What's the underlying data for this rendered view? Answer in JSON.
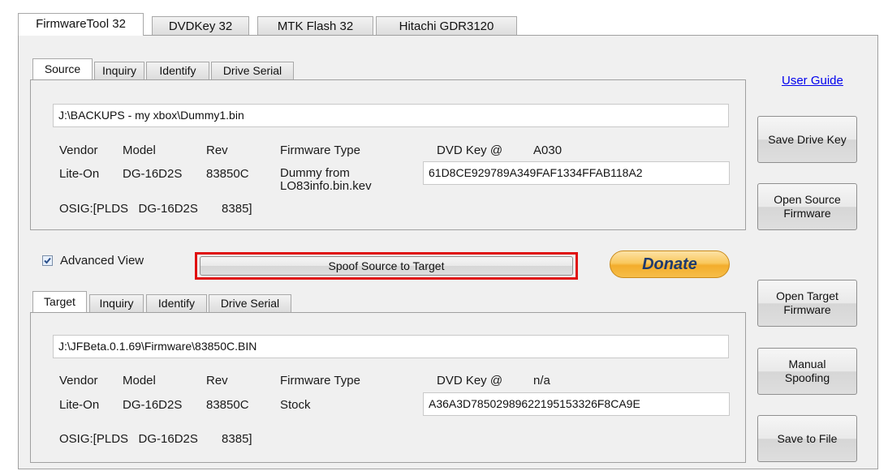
{
  "tabs": [
    "FirmwareTool 32",
    "DVDKey 32",
    "MTK Flash 32",
    "Hitachi GDR3120"
  ],
  "user_guide": "User Guide",
  "source": {
    "tabs": [
      "Source",
      "Inquiry",
      "Identify",
      "Drive Serial"
    ],
    "path": "J:\\BACKUPS - my xbox\\Dummy1.bin",
    "vendor_label": "Vendor",
    "model_label": "Model",
    "rev_label": "Rev",
    "fw_type_label": "Firmware Type",
    "dvd_key_label": "DVD Key @",
    "dvd_key_addr": "A030",
    "vendor": "Lite-On",
    "model": "DG-16D2S",
    "rev": "83850C",
    "fw_type": "Dummy from LO83info.bin.kev",
    "dvd_key": "61D8CE929789A349FAF1334FFAB118A2",
    "osig": "OSIG:[PLDS   DG-16D2S       8385]"
  },
  "advanced_view": {
    "label": "Advanced View",
    "checked": true
  },
  "spoof_button": "Spoof Source to Target",
  "donate_button": "Donate",
  "target": {
    "tabs": [
      "Target",
      "Inquiry",
      "Identify",
      "Drive Serial"
    ],
    "path": "J:\\JFBeta.0.1.69\\Firmware\\83850C.BIN",
    "vendor_label": "Vendor",
    "model_label": "Model",
    "rev_label": "Rev",
    "fw_type_label": "Firmware Type",
    "dvd_key_label": "DVD Key @",
    "dvd_key_addr": "n/a",
    "vendor": "Lite-On",
    "model": "DG-16D2S",
    "rev": "83850C",
    "fw_type": "Stock",
    "dvd_key": "A36A3D78502989622195153326F8CA9E",
    "osig": "OSIG:[PLDS   DG-16D2S       8385]"
  },
  "side_buttons": {
    "save_drive_key": "Save Drive Key",
    "open_source_fw": "Open Source Firmware",
    "open_target_fw": "Open Target Firmware",
    "manual_spoofing": "Manual Spoofing",
    "save_to_file": "Save to File"
  },
  "colors": {
    "highlight": "#e01010",
    "link": "#0000ee",
    "donate": "#f5b43a"
  }
}
